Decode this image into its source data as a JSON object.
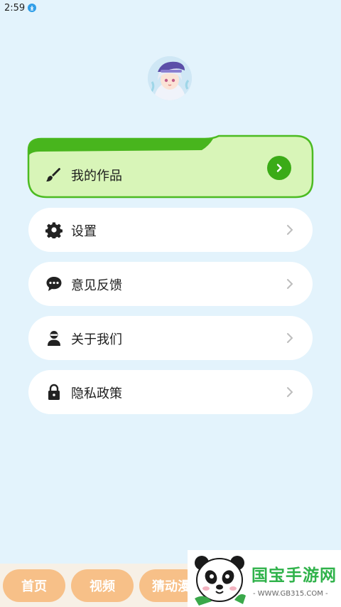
{
  "status_bar": {
    "time": "2:59"
  },
  "profile": {
    "avatar": "anime-avatar"
  },
  "featured": {
    "label": "我的作品",
    "icon": "brush-icon",
    "accent": "#3bab17",
    "bg": "#d8f5b8"
  },
  "menu": [
    {
      "label": "设置",
      "icon": "gear-icon"
    },
    {
      "label": "意见反馈",
      "icon": "chat-bubble-icon"
    },
    {
      "label": "关于我们",
      "icon": "person-icon"
    },
    {
      "label": "隐私政策",
      "icon": "lock-icon"
    }
  ],
  "bottom_nav": [
    {
      "label": "首页"
    },
    {
      "label": "视频"
    },
    {
      "label": "猜动漫"
    }
  ],
  "watermark": {
    "title": "国宝手游网",
    "url": "- WWW.GB315.COM -"
  },
  "colors": {
    "background": "#e3f3fc",
    "nav_button": "#f7c088"
  }
}
